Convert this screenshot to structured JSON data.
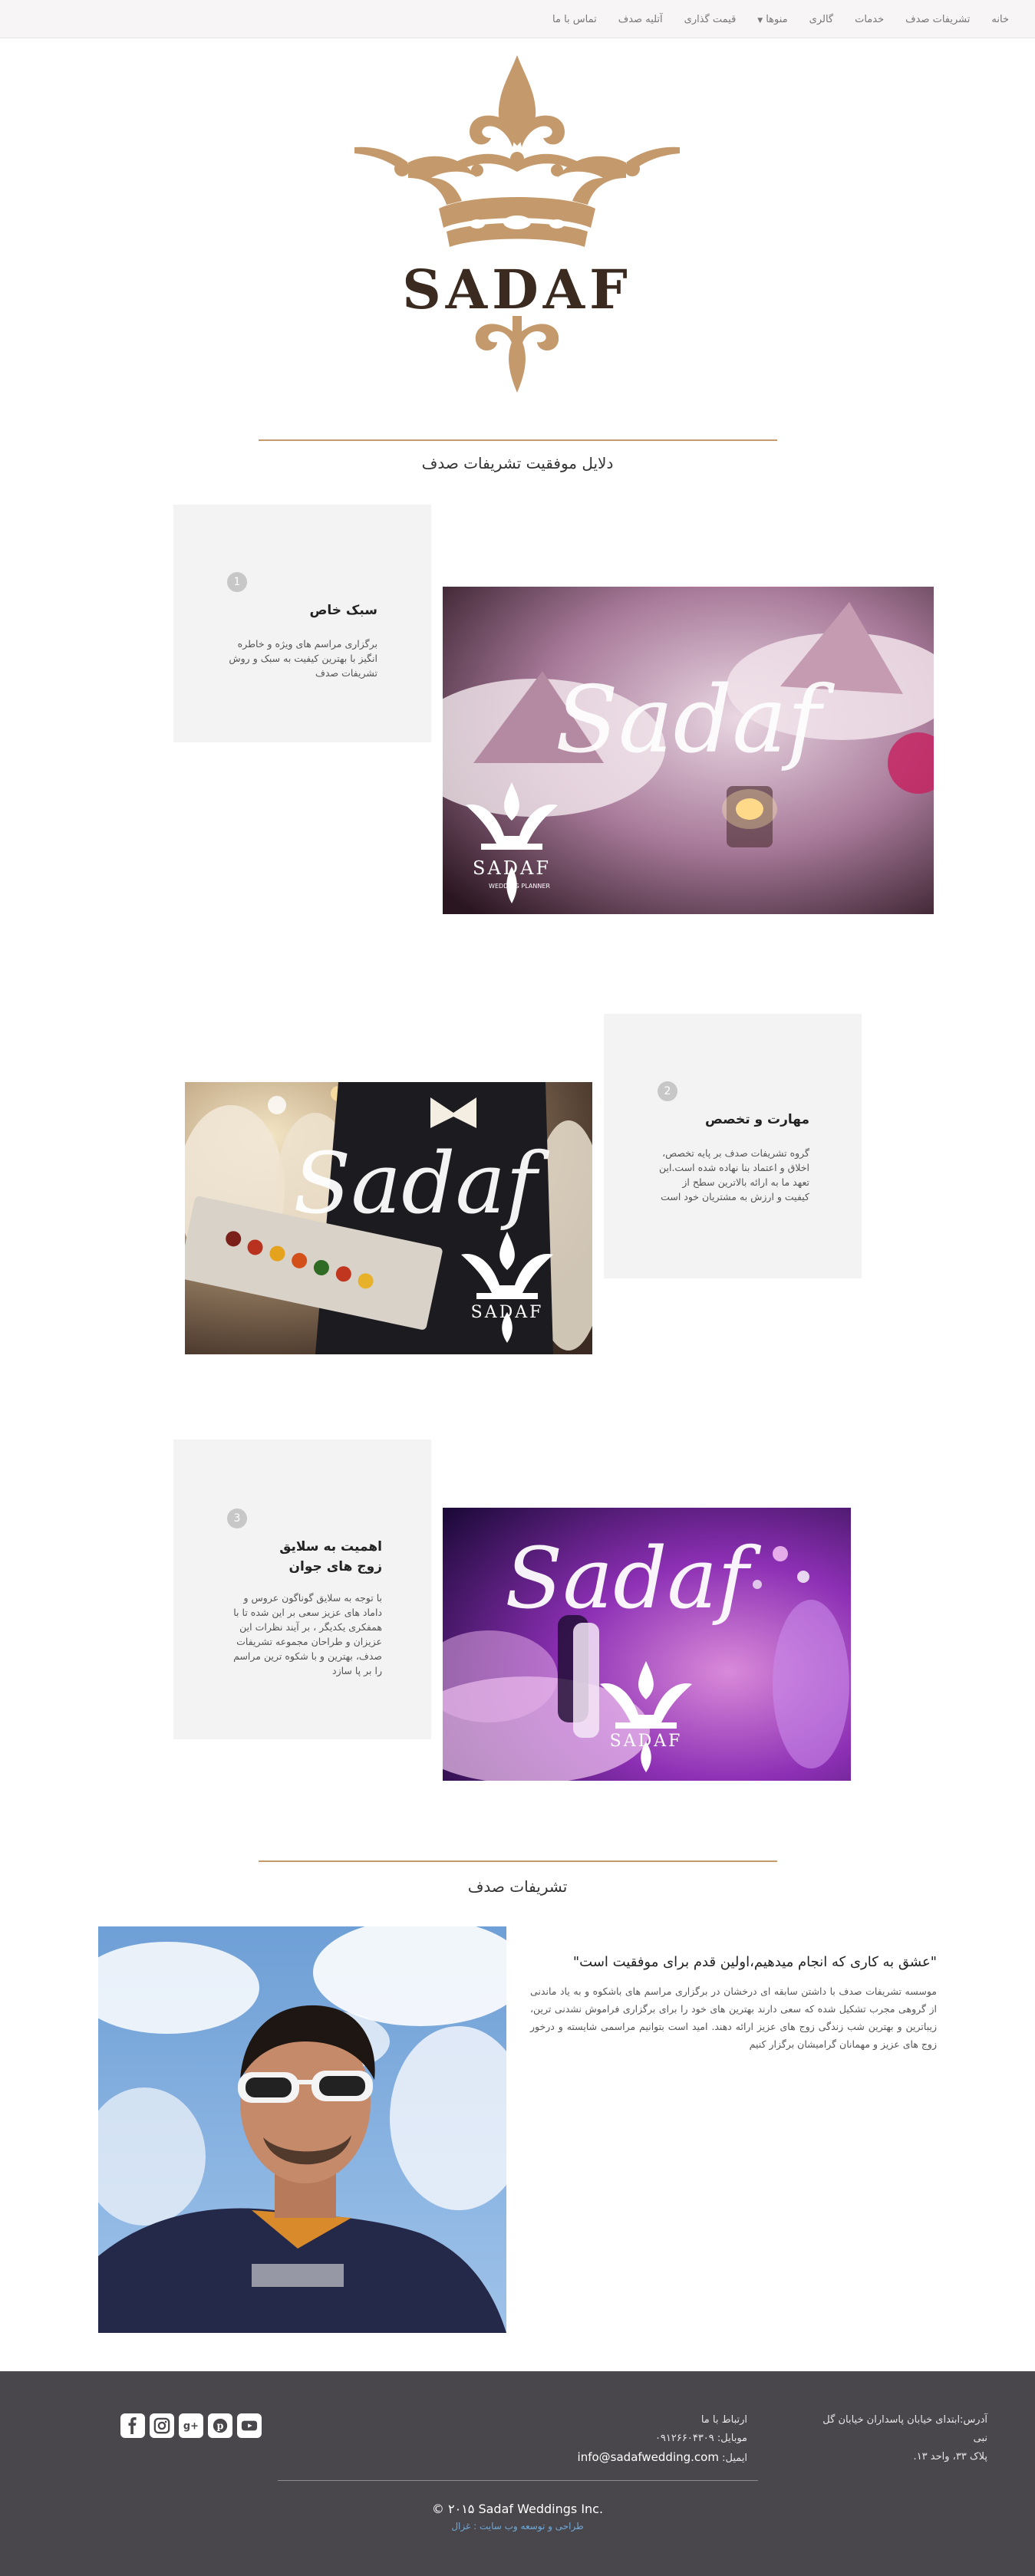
{
  "nav": {
    "items": [
      "خانه",
      "تشریفات صدف",
      "خدمات",
      "گالری",
      "منوها",
      "قیمت گذاری",
      "آتلیه صدف",
      "تماس با ما"
    ]
  },
  "logo": {
    "wordmark": "SADAF"
  },
  "section1": {
    "title": "دلایل موفقیت تشریفات صدف"
  },
  "features": [
    {
      "number": "1",
      "title": "سبک خاص",
      "text": "برگزاری مراسم های ویژه و خاطره انگیز با بهترین کیفیت به سبک و روش تشریفات صدف",
      "photo_watermark": "Sadaf",
      "photo_logo": "SADAF",
      "photo_logo_sub": "WEDDING PLANNER"
    },
    {
      "number": "2",
      "title": "مهارت و تخصص",
      "text": "گروه تشریفات صدف بر پایه تخصص، اخلاق و اعتماد بنا نهاده شده است.این تعهد ما به ارائه بالاترین سطح از کیفیت و ارزش به مشتریان خود است",
      "photo_watermark": "Sadaf",
      "photo_logo": "SADAF"
    },
    {
      "number": "3",
      "title": "اهمیت به سلایق زوج های جوان",
      "text": "با توجه به سلایق گوناگون عروس و داماد های عزیز سعی بر این شده تا با همفکری یکدیگر ، بر آیند نظرات این عزیزان و طراحان مجموعه تشریفات صدف، بهترین و با شکوه ترین مراسم را بر پا سازد",
      "photo_watermark": "Sadaf",
      "photo_logo": "SADAF"
    }
  ],
  "section2": {
    "title": "تشریفات صدف"
  },
  "about": {
    "quote": "\"عشق به کاری که انجام میدهیم،اولین قدم برای موفقیت است\"",
    "text": "موسسه تشریفات صدف با داشتن سابقه ای درخشان در برگزاری مراسم های باشکوه و به یاد ماندنی از گروهی مجرب تشکیل شده که سعی دارند بهترین های خود را برای برگزاری فراموش نشدنی ترین، زیباترین و بهترین شب زندگی زوج های عزیز ارائه دهند. امید است بتوانیم مراسمی شایسته و درخور زوج های عزیز و مهمانان گرامیشان برگزار کنیم"
  },
  "footer": {
    "address_line1": "آدرس:ابتدای خیابان پاسداران خیابان گل نبی",
    "address_line2": "پلاک ۳۳، واحد ۱۳.",
    "contact_label": "ارتباط با ما",
    "mobile": "موبایل: ۰۹۱۲۶۶۰۴۳۰۹",
    "email_label": "ایمیل:",
    "email": "info@sadafwedding.com",
    "copyright": "© ۲۰۱۵ Sadaf Weddings Inc.",
    "credit": "طراحی و توسعه وب سایت : غزال",
    "social": [
      "youtube-icon",
      "pinterest-icon",
      "google-plus-icon",
      "instagram-icon",
      "facebook-icon"
    ]
  },
  "colors": {
    "accent": "#c49a6c",
    "footer_bg": "#4a474c",
    "card_bg": "#f3f3f3",
    "link": "#6fa8d6"
  }
}
